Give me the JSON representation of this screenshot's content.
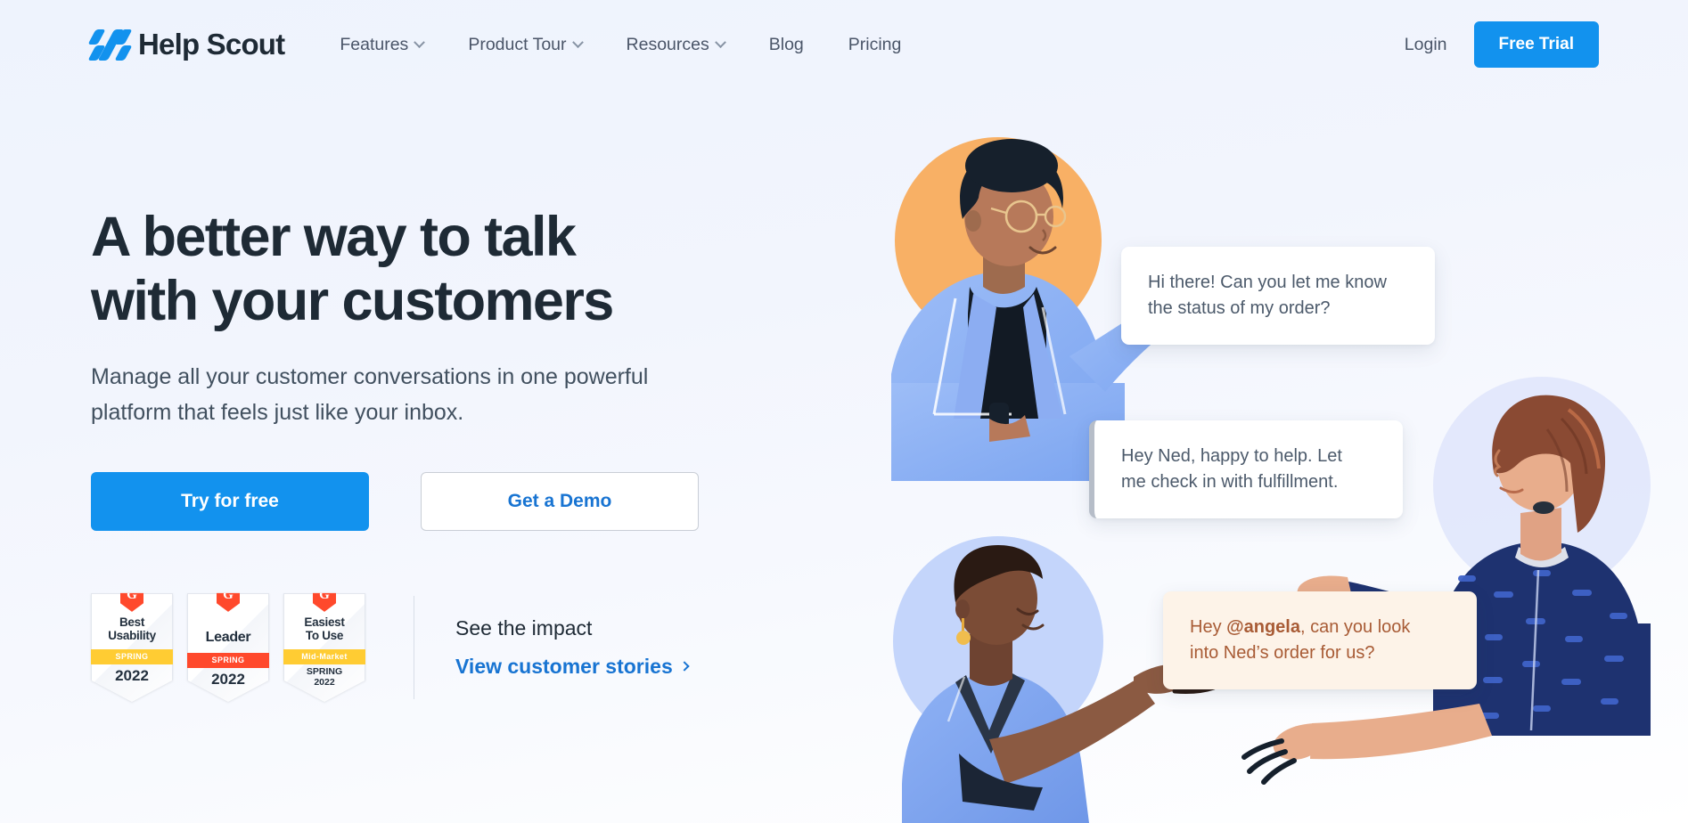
{
  "header": {
    "brand_name": "Help Scout",
    "logo_icon": "helpscout-logo-icon",
    "nav": [
      {
        "label": "Features",
        "has_dropdown": true
      },
      {
        "label": "Product Tour",
        "has_dropdown": true
      },
      {
        "label": "Resources",
        "has_dropdown": true
      },
      {
        "label": "Blog",
        "has_dropdown": false
      },
      {
        "label": "Pricing",
        "has_dropdown": false
      }
    ],
    "login_label": "Login",
    "free_trial_label": "Free Trial"
  },
  "hero": {
    "headline": "A better way to talk with your customers",
    "subhead": "Manage all your customer conversations in one powerful platform that feels just like your inbox.",
    "primary_cta": "Try for free",
    "secondary_cta": "Get a Demo"
  },
  "badges": [
    {
      "source": "G2",
      "title_line1": "Best",
      "title_line2": "Usability",
      "ribbon": "SPRING",
      "ribbon_color": "#ffcc33",
      "year": "2022",
      "sub": ""
    },
    {
      "source": "G2",
      "title_line1": "Leader",
      "title_line2": "",
      "ribbon": "SPRING",
      "ribbon_color": "#ff492c",
      "year": "2022",
      "sub": ""
    },
    {
      "source": "G2",
      "title_line1": "Easiest",
      "title_line2": "To Use",
      "ribbon": "Mid-Market",
      "ribbon_color": "#ffcc33",
      "year": "SPRING",
      "sub": "2022"
    }
  ],
  "impact": {
    "title": "See the impact",
    "link_label": "View customer stories",
    "link_arrow": "chevron-right-icon"
  },
  "conversation": [
    {
      "id": "bubble-1",
      "style": "white",
      "line1": "Hi there! Can you let me know",
      "line2": "the status of my order?"
    },
    {
      "id": "bubble-2",
      "style": "bar",
      "line1": "Hey Ned, happy to help. Let",
      "line2": "me check in with fulfillment."
    },
    {
      "id": "bubble-3",
      "style": "peach",
      "prefix": "Hey ",
      "mention": "@angela",
      "suffix": ", can you look",
      "line2": "into Ned’s order for us?"
    }
  ],
  "colors": {
    "accent_blue": "#1292ee",
    "link_blue": "#1874d2",
    "text_dark": "#1e2a35",
    "text_muted": "#4a5568",
    "page_bg_top": "#eef3fd",
    "page_bg_bottom": "#ffffff",
    "badge_orange": "#ff492c",
    "badge_yellow": "#ffcc33",
    "peach_bubble": "#fdf3e8",
    "peach_text": "#a85b35",
    "halo_orange": "#f8b065",
    "halo_blue": "#aec5f7",
    "halo_lavender": "#dde3fb"
  }
}
